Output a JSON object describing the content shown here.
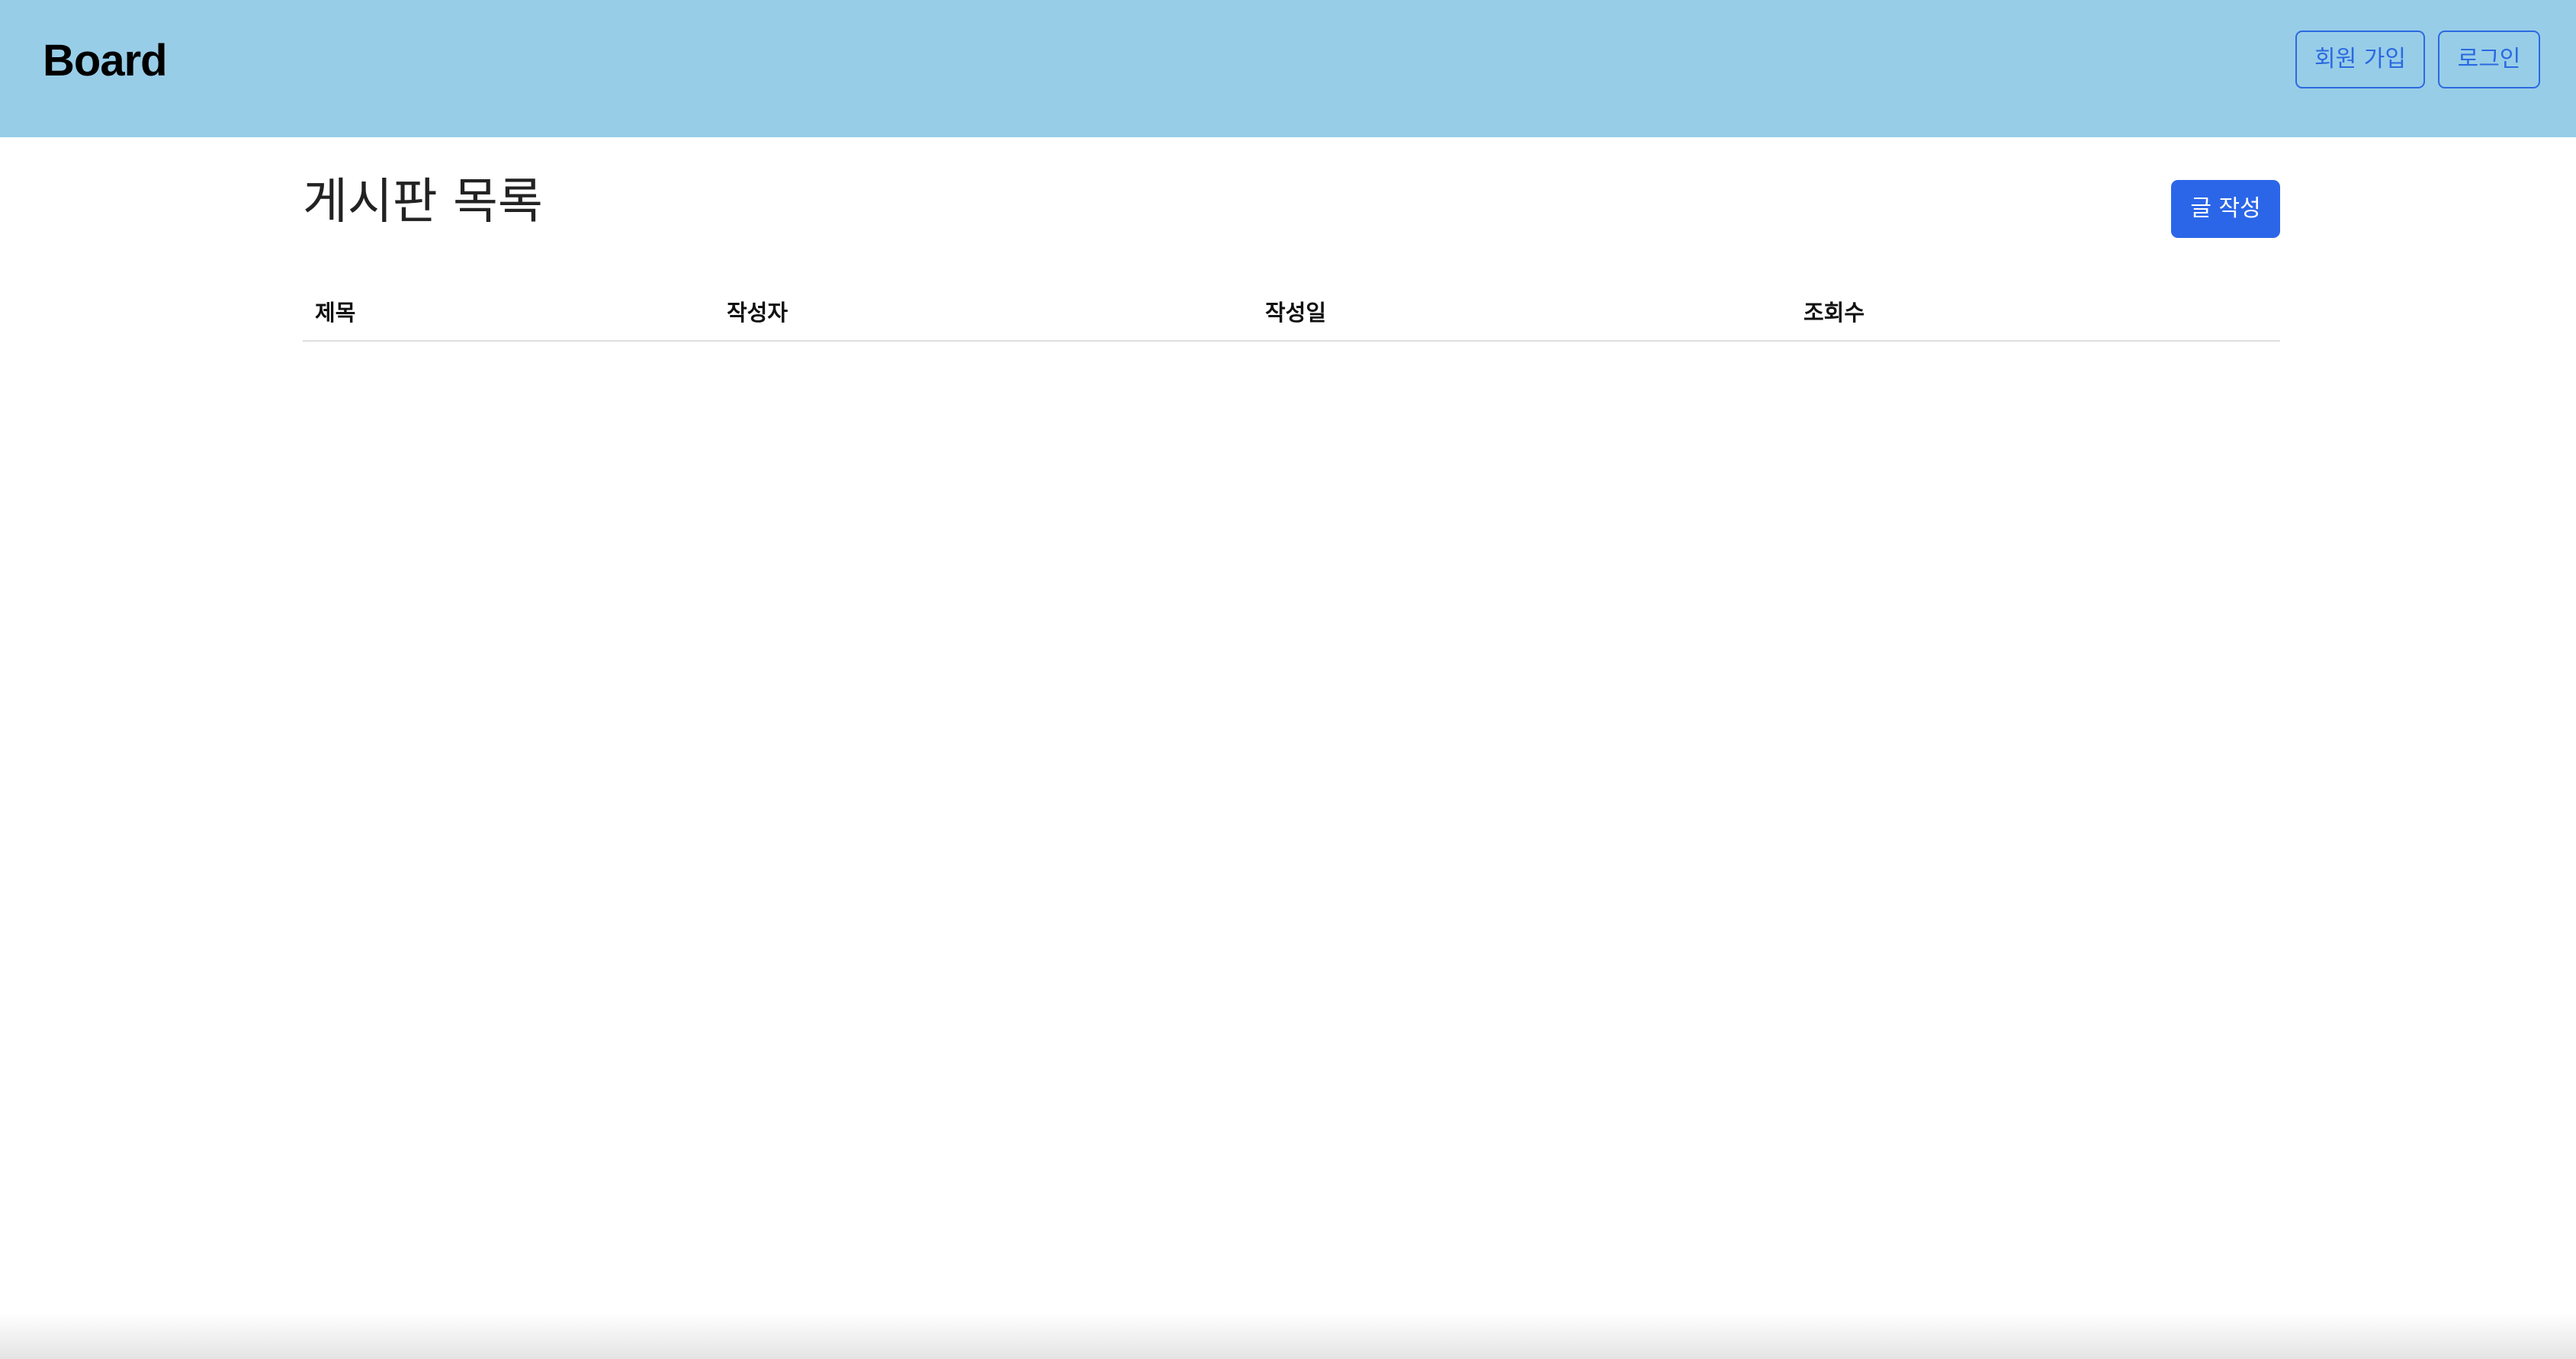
{
  "header": {
    "brand": "Board",
    "signup_label": "회원 가입",
    "login_label": "로그인",
    "background_color": "#98cde8",
    "accent_color": "#2a6ae0"
  },
  "main": {
    "title": "게시판 목록",
    "write_button_label": "글 작성",
    "write_button_color": "#2b66e9",
    "table": {
      "columns": [
        "제목",
        "작성자",
        "작성일",
        "조회수"
      ],
      "rows": []
    }
  }
}
